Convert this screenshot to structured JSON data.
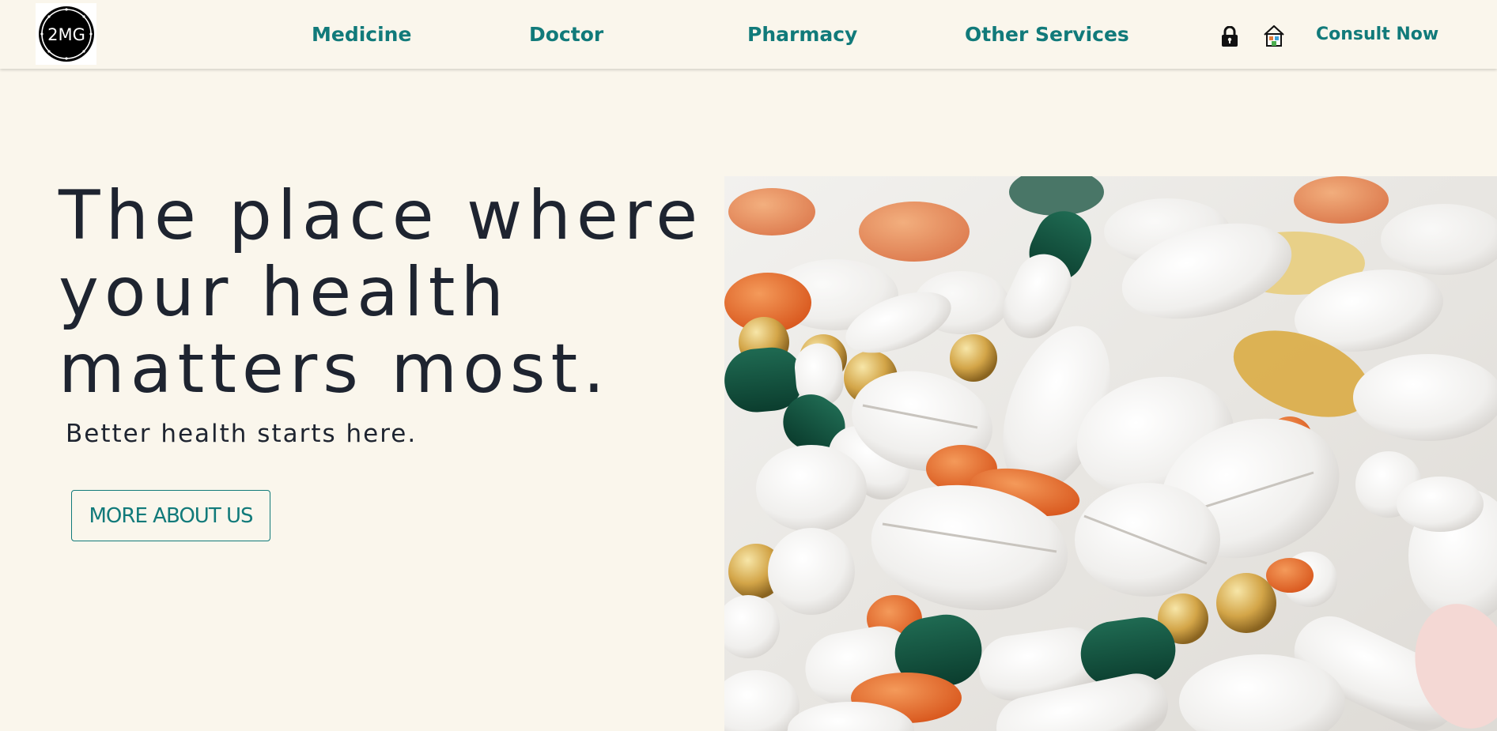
{
  "brand": {
    "logo_text": "2MG"
  },
  "nav": {
    "links": [
      {
        "label": "Medicine"
      },
      {
        "label": "Doctor"
      },
      {
        "label": "Pharmacy"
      },
      {
        "label": "Other Services"
      }
    ],
    "icons": [
      "lock-icon",
      "home-icon"
    ],
    "cta_label": "Consult Now"
  },
  "hero": {
    "title_lines": [
      "The place where",
      "your health",
      "matters most."
    ],
    "subtitle": "Better health starts here.",
    "button_label": "MORE ABOUT US",
    "image_subject": "pills-photo"
  },
  "colors": {
    "background": "#faf6ec",
    "accent": "#117a7a",
    "text": "#1e2430"
  }
}
